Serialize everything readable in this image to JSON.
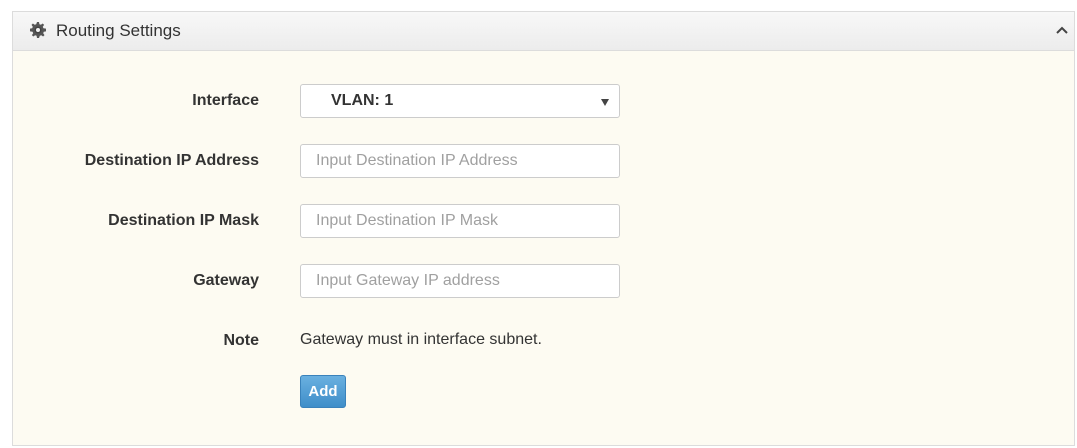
{
  "panel": {
    "title": "Routing Settings",
    "icon": "gear-icon",
    "collapse_icon": "chevron-up-icon"
  },
  "form": {
    "interface": {
      "label": "Interface",
      "selected": "VLAN: 1"
    },
    "destination_ip": {
      "label": "Destination IP Address",
      "placeholder": "Input Destination IP Address",
      "value": ""
    },
    "destination_mask": {
      "label": "Destination IP Mask",
      "placeholder": "Input Destination IP Mask",
      "value": ""
    },
    "gateway": {
      "label": "Gateway",
      "placeholder": "Input Gateway IP address",
      "value": ""
    },
    "note": {
      "label": "Note",
      "text": "Gateway must in interface subnet."
    },
    "add_label": "Add"
  },
  "colors": {
    "accent": "#4a97d0",
    "panel_bg": "#fdfbf2"
  }
}
